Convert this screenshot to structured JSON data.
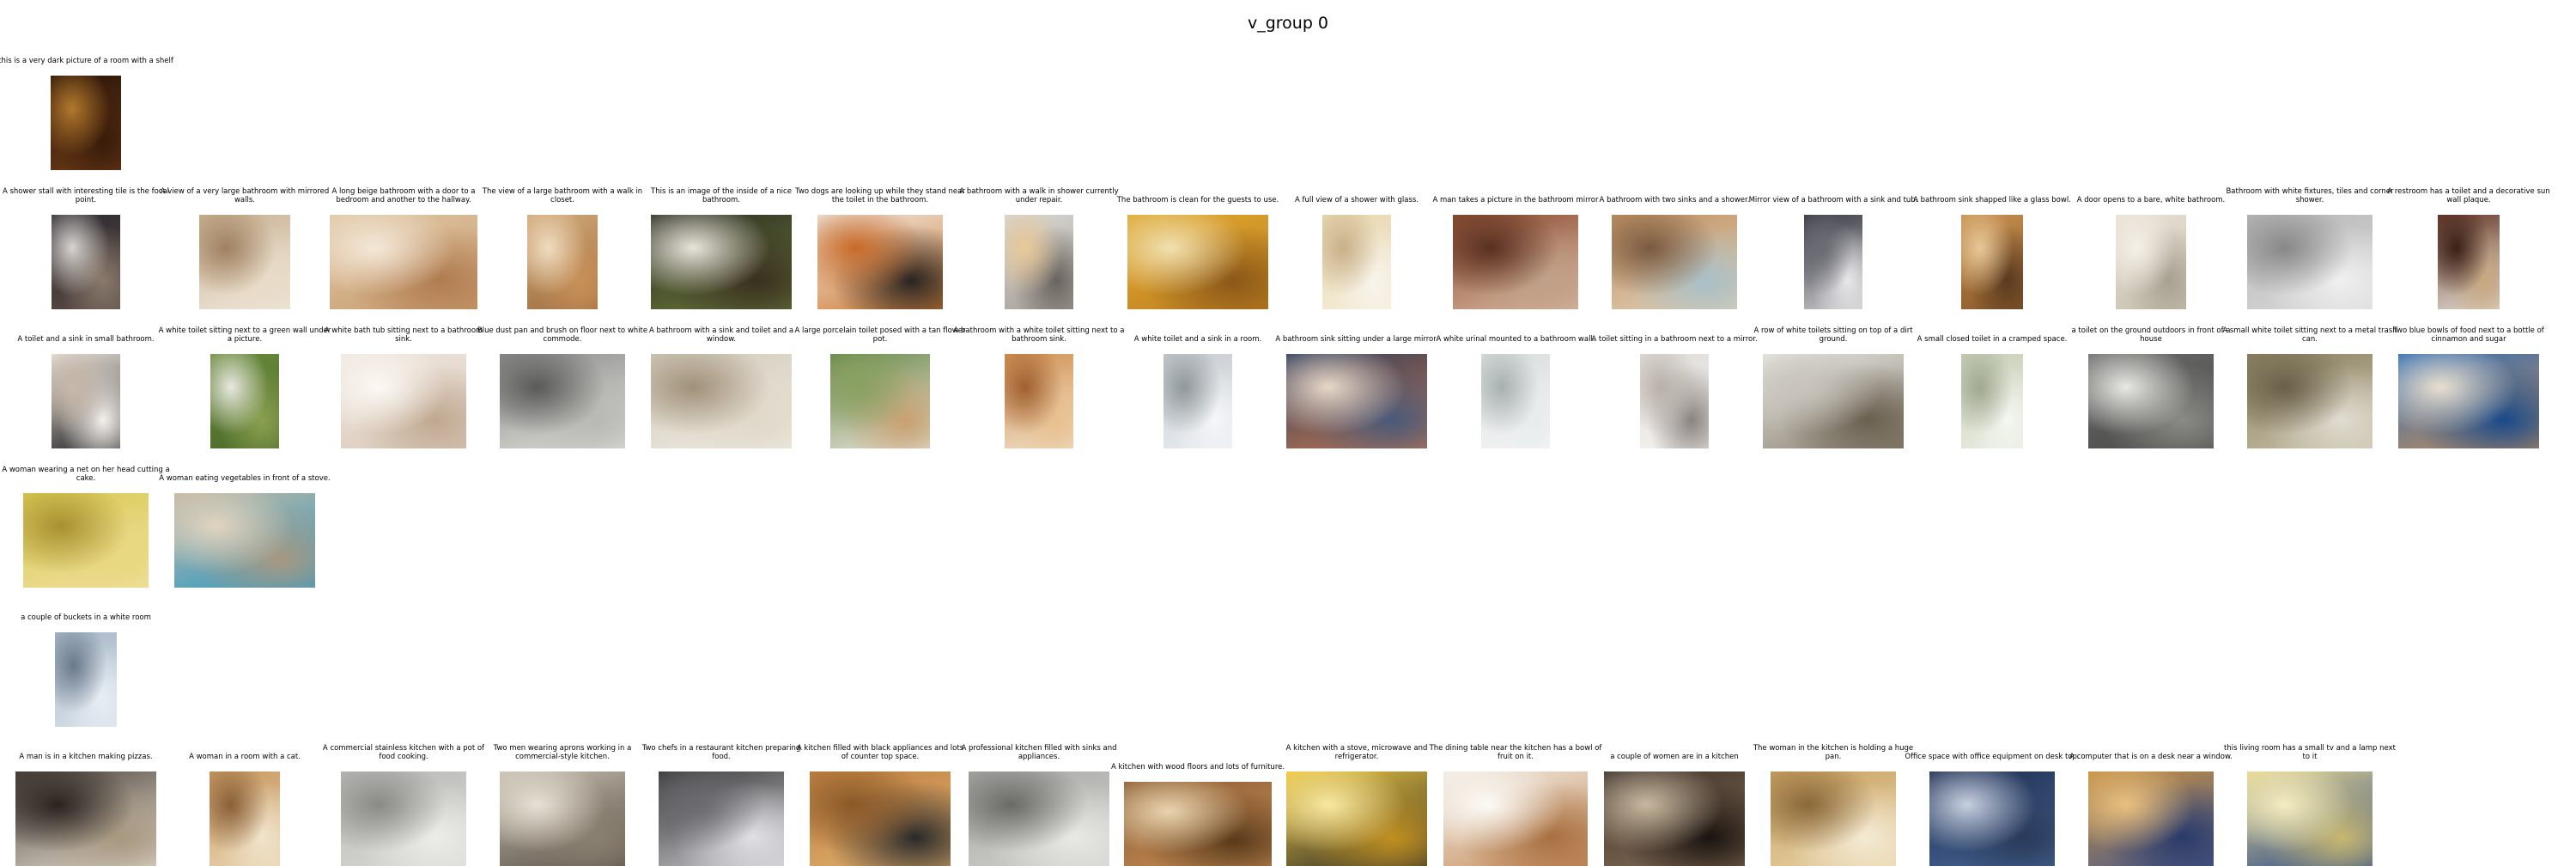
{
  "title": "v_group 0",
  "rows": [
    [
      {
        "caption": "this is a very dark picture of a room with a shelf",
        "colors": [
          "#2a1408",
          "#6b3a16",
          "#b2782c",
          "#3a1c0a"
        ]
      }
    ],
    [
      {
        "caption": "A shower stall with interesting tile is the focal point.",
        "colors": [
          "#2c2a30",
          "#5a4a44",
          "#d8d4d0",
          "#8a7a6c"
        ]
      },
      {
        "caption": "A view of a very large bathroom with mirrored walls.",
        "colors": [
          "#c8b090",
          "#f0e8dc",
          "#a08060",
          "#e8dcc8"
        ]
      },
      {
        "caption": "A long beige bathroom with a door to a bedroom and another to the hallway.",
        "colors": [
          "#e0c8a8",
          "#c89c6c",
          "#f4e8d8",
          "#b07c50"
        ]
      },
      {
        "caption": "The view of a large bathroom with a walk in closet.",
        "colors": [
          "#d0a878",
          "#a07040",
          "#f0dcc0",
          "#c89058"
        ]
      },
      {
        "caption": "This is an image of the inside of a nice bathroom.",
        "colors": [
          "#2a2a22",
          "#6a7a3a",
          "#e8e4dc",
          "#3a3020"
        ]
      },
      {
        "caption": "Two dogs are looking up while they stand near the toilet in the bathroom.",
        "colors": [
          "#f0ece8",
          "#d07a30",
          "#c86a28",
          "#2a2420"
        ]
      },
      {
        "caption": "A bathroom with a walk in shower currently under repair.",
        "colors": [
          "#d8d8d4",
          "#a8a098",
          "#e8c898",
          "#6a6460"
        ]
      },
      {
        "caption": "The bathroom is clean for the guests to use.",
        "colors": [
          "#e0a830",
          "#c08020",
          "#f0e0b0",
          "#8a5818"
        ]
      },
      {
        "caption": "A full view of a shower with glass.",
        "colors": [
          "#e8d8b0",
          "#f4ecd8",
          "#c8b088",
          "#f8f4ec"
        ]
      },
      {
        "caption": "A man takes a picture in the bathroom mirror",
        "colors": [
          "#8a4a30",
          "#d8b8a0",
          "#5a3020",
          "#c0a088"
        ]
      },
      {
        "caption": "A bathroom with two sinks and a shower.",
        "colors": [
          "#c09060",
          "#e0d0b8",
          "#7a5a40",
          "#a8c0c8"
        ]
      },
      {
        "caption": "Mirror view of a bathroom with a sink and tub.",
        "colors": [
          "#3a3a44",
          "#c8c8cc",
          "#6a6a72",
          "#e8e8ea"
        ]
      },
      {
        "caption": "A bathroom sink shapped like a glass bowl.",
        "colors": [
          "#c89050",
          "#8a5a2a",
          "#e8c898",
          "#5a3a20"
        ]
      },
      {
        "caption": "A door opens to a bare, white bathroom.",
        "colors": [
          "#e8e0d4",
          "#c8c0b0",
          "#f4f0e8",
          "#a8a090"
        ]
      },
      {
        "caption": "Bathroom with white fixtures, tiles and corner shower.",
        "colors": [
          "#b8b8b8",
          "#d8d8d8",
          "#888888",
          "#f0f0f0"
        ]
      },
      {
        "caption": "A restroom has a toilet and a decorative sun wall plaque.",
        "colors": [
          "#6a3a2a",
          "#e0dcd4",
          "#3a2018",
          "#c8a880"
        ]
      }
    ],
    [
      {
        "caption": "A toilet and a sink in small bathroom.",
        "colors": [
          "#e8e0d8",
          "#2a2a2a",
          "#c8b8a8",
          "#f4f0ec"
        ]
      },
      {
        "caption": "A white toilet sitting next to a green wall under a picture.",
        "colors": [
          "#6a8a3a",
          "#4a6a2a",
          "#e8e8e0",
          "#8aa050"
        ]
      },
      {
        "caption": "A white bath tub sitting next to a bathroom sink.",
        "colors": [
          "#f0e8e0",
          "#d8c8b8",
          "#fcf8f4",
          "#c0a890"
        ]
      },
      {
        "caption": "Blue dust pan and brush on floor next to white commode.",
        "colors": [
          "#8a8a88",
          "#e0e0dc",
          "#5a5a58",
          "#b8b8b4"
        ]
      },
      {
        "caption": "A bathroom with a sink and toilet and a window.",
        "colors": [
          "#d0c8b8",
          "#f0ece4",
          "#a09078",
          "#e0d8c8"
        ]
      },
      {
        "caption": "A large porcelain toilet posed with a tan flower pot.",
        "colors": [
          "#6a8a4a",
          "#e8e4dc",
          "#8aa060",
          "#c8a070"
        ]
      },
      {
        "caption": "A bathroom with a white toilet sitting next to a bathroom sink.",
        "colors": [
          "#d09050",
          "#f0e0c8",
          "#a06030",
          "#e8c090"
        ]
      },
      {
        "caption": "A white toilet and a sink in a room.",
        "colors": [
          "#c8ccd0",
          "#e8ecf0",
          "#90989c",
          "#f4f6f8"
        ]
      },
      {
        "caption": "A bathroom sink sitting under a large mirror.",
        "colors": [
          "#2a3a5a",
          "#c87a50",
          "#e8d8c8",
          "#4a5a7a"
        ]
      },
      {
        "caption": "A white urinal mounted to a bathroom wall.",
        "colors": [
          "#d8dcdc",
          "#f4f6f6",
          "#a8b0b0",
          "#e8ecec"
        ]
      },
      {
        "caption": "A toilet sitting in a bathroom next to a mirror.",
        "colors": [
          "#e0dcd8",
          "#f4f2f0",
          "#b8b0a8",
          "#8a8480"
        ]
      },
      {
        "caption": "A row of white toilets sitting on top of a dirt ground.",
        "colors": [
          "#e8e8e4",
          "#8a8070",
          "#c8c4bc",
          "#6a6050"
        ]
      },
      {
        "caption": "A small closed toilet in a cramped space.",
        "colors": [
          "#c8d0b8",
          "#e8ece0",
          "#a0a890",
          "#f4f6f0"
        ]
      },
      {
        "caption": "a toilet on the ground outdoors in front of a house",
        "colors": [
          "#6a6a68",
          "#4a4a48",
          "#e8e8e4",
          "#8a8a86"
        ]
      },
      {
        "caption": "A small white toilet sitting next to a metal trash can.",
        "colors": [
          "#8a8060",
          "#c8c0a8",
          "#6a6048",
          "#e0dcd0"
        ]
      },
      {
        "caption": "Two blue bowls of food next to a bottle of cinnamon and sugar",
        "colors": [
          "#2a6ab8",
          "#c89058",
          "#e8e0d0",
          "#1a4a8a"
        ]
      }
    ],
    [
      {
        "caption": "A woman wearing a net on her head cutting a cake.",
        "colors": [
          "#d8c850",
          "#f0e0a0",
          "#a89030",
          "#e8d880"
        ]
      },
      {
        "caption": "A woman eating vegetables in front of a stove.",
        "colors": [
          "#c8b8a0",
          "#2a9ac8",
          "#e0d4c0",
          "#a89880"
        ]
      }
    ],
    [
      {
        "caption": "a couple of buckets in a white room",
        "colors": [
          "#a8b8c8",
          "#d8e0e8",
          "#6a7a8a",
          "#e8eef4"
        ]
      }
    ],
    [
      {
        "caption": "A man is in a kitchen making pizzas.",
        "colors": [
          "#4a4038",
          "#e8e0d4",
          "#2a2420",
          "#a89880"
        ]
      },
      {
        "caption": "A woman in a room with a cat.",
        "colors": [
          "#c89860",
          "#e8d4b0",
          "#8a6038",
          "#f0e4cc"
        ]
      },
      {
        "caption": "A commercial stainless kitchen with a pot of food cooking.",
        "colors": [
          "#b8b8b4",
          "#d8d8d4",
          "#8a8a86",
          "#ecece8"
        ]
      },
      {
        "caption": "Two men wearing aprons working in a commercial-style kitchen.",
        "colors": [
          "#c8c0b0",
          "#5a5048",
          "#e8e0d4",
          "#8a8070"
        ]
      },
      {
        "caption": "Two chefs in a restaurant kitchen preparing food.",
        "colors": [
          "#3a3a3c",
          "#c8c8cc",
          "#6a6a6e",
          "#e0e0e4"
        ]
      },
      {
        "caption": "A kitchen filled with black appliances and lots of counter top space.",
        "colors": [
          "#c08040",
          "#e0b070",
          "#8a5828",
          "#2a2a2a"
        ]
      },
      {
        "caption": "A professional kitchen filled with sinks and appliances.",
        "colors": [
          "#a8a8a4",
          "#d0d0cc",
          "#6a6a66",
          "#e8e8e4"
        ]
      },
      {
        "caption": "A kitchen with wood floors and lots of furniture.",
        "colors": [
          "#8a5a30",
          "#c89058",
          "#e8d4b0",
          "#5a3a1a"
        ]
      },
      {
        "caption": "A kitchen with a stove, microwave and refrigerator.",
        "colors": [
          "#f0c840",
          "#2a2a2a",
          "#f8e8a0",
          "#c09020"
        ]
      },
      {
        "caption": "The dining table near the kitchen has a bowl of fruit on it.",
        "colors": [
          "#f0ece4",
          "#c89060",
          "#fcfaf6",
          "#a87040"
        ]
      },
      {
        "caption": "a couple of women are in a kitchen",
        "colors": [
          "#3a3028",
          "#8a7058",
          "#c8b8a0",
          "#1a1410"
        ]
      },
      {
        "caption": "The woman in the kitchen is holding a huge pan.",
        "colors": [
          "#c8a060",
          "#e8d4a8",
          "#8a6838",
          "#f4ead4"
        ]
      },
      {
        "caption": "Office space with office equipment on desk top.",
        "colors": [
          "#1a2a4a",
          "#4a6a9a",
          "#c8d0e0",
          "#2a3a5a"
        ]
      },
      {
        "caption": "A computer that is on a desk near a window.",
        "colors": [
          "#c89040",
          "#4a5a8a",
          "#e8c080",
          "#2a3a6a"
        ]
      },
      {
        "caption": "this living room has a small tv and a lamp next to it",
        "colors": [
          "#e8d890",
          "#2a4a8a",
          "#f4ecc0",
          "#c8b870"
        ]
      }
    ]
  ]
}
